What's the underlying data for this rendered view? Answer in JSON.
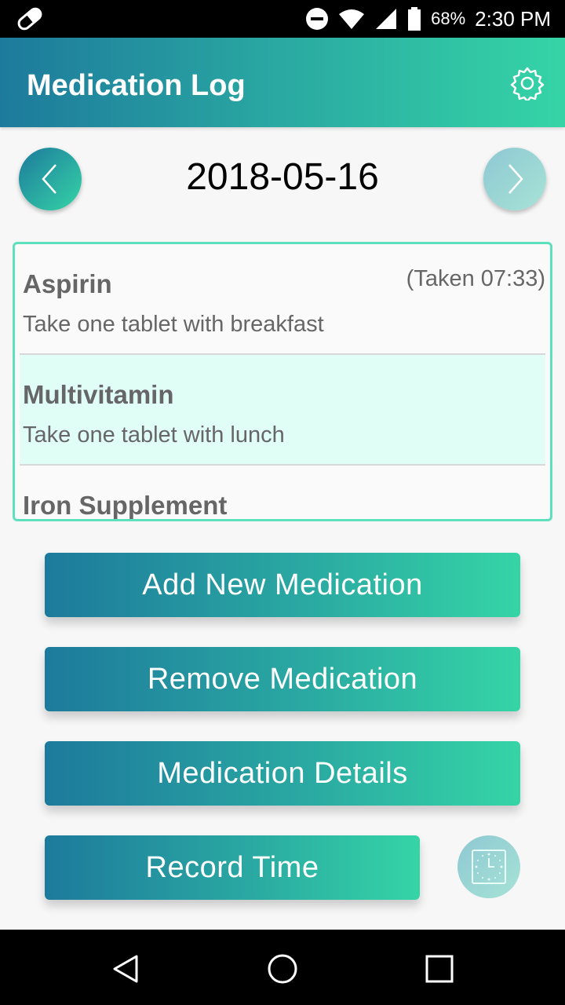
{
  "status_bar": {
    "battery_percent": "68%",
    "time": "2:30 PM",
    "icons": [
      "pill-icon",
      "do-not-disturb-icon",
      "wifi-icon",
      "cell-signal-icon",
      "battery-icon"
    ]
  },
  "app_bar": {
    "title": "Medication Log",
    "settings_icon": "gear-icon"
  },
  "date_nav": {
    "date": "2018-05-16",
    "prev_icon": "chevron-left-icon",
    "next_icon": "chevron-right-icon"
  },
  "medications": [
    {
      "name": "Aspirin",
      "instructions": "Take one tablet with breakfast",
      "status": "(Taken 07:33)"
    },
    {
      "name": "Multivitamin",
      "instructions": "Take one tablet with lunch",
      "status": ""
    },
    {
      "name": "Iron Supplement",
      "instructions": "",
      "status": ""
    }
  ],
  "actions": {
    "add": "Add New Medication",
    "remove": "Remove Medication",
    "details": "Medication Details",
    "record_time": "Record Time",
    "clock_icon": "clock-icon"
  },
  "system_nav": {
    "icons": [
      "back-icon",
      "home-icon",
      "recents-icon"
    ]
  },
  "colors": {
    "gradient_start": "#1d7a9c",
    "gradient_end": "#35d4a6",
    "list_border": "#5ee0bc",
    "selected_row": "#e0fdf6"
  }
}
